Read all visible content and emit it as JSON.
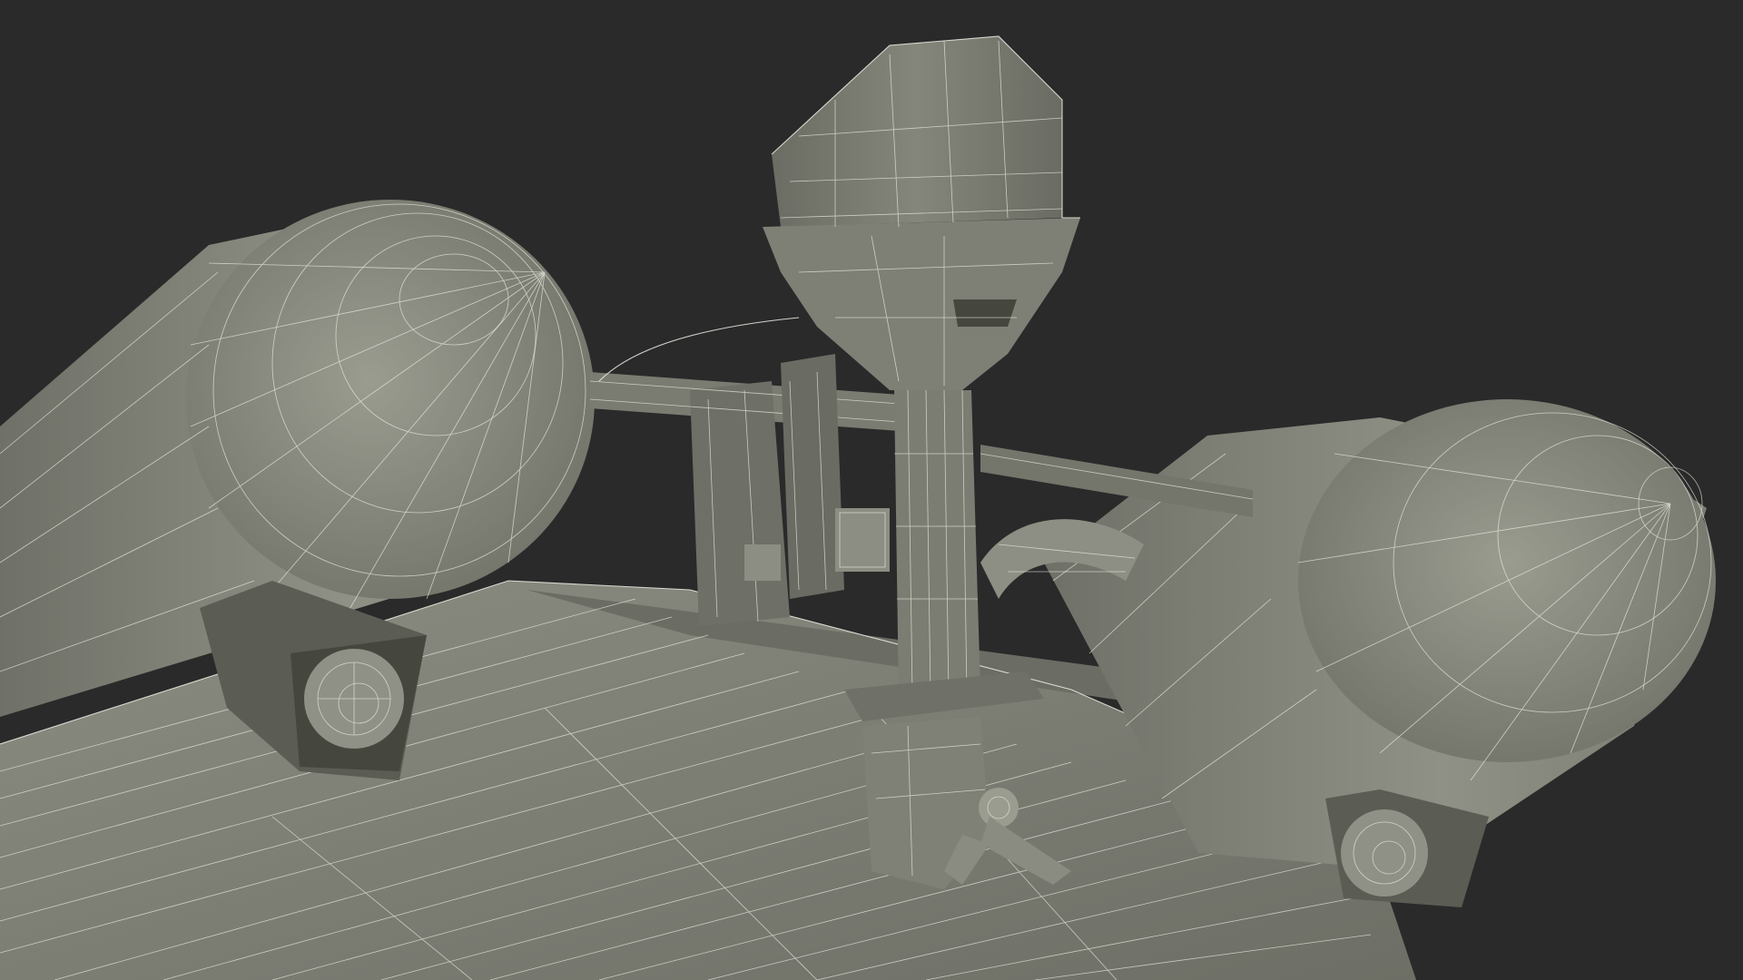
{
  "scene": {
    "subject": "wireframe-render",
    "colors": {
      "background": "#2a2a2a",
      "surface_light": "#8e9085",
      "surface_mid": "#74766c",
      "surface_dark": "#55574f",
      "wire": "#eef0e6"
    }
  }
}
